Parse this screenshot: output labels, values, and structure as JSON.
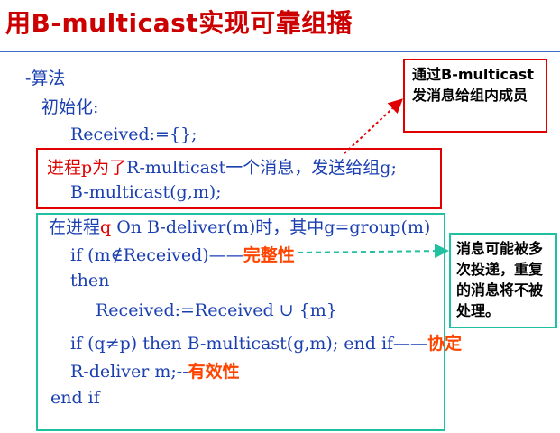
{
  "title": "用B-multicast实现可靠组播",
  "algo_label": "-算法",
  "init_label": "初始化:",
  "received_init": "Received:={};",
  "send_desc_prefix": "进程p为了",
  "send_desc_mid": "R-multicast一个消息，发送给组",
  "send_desc_suffix": "g;",
  "bmulticast_call": "B-multicast(g,m);",
  "deliver_prefix": "在进程",
  "deliver_q": "q",
  "deliver_rest": " On B-deliver(m)时，其中g=group(m)",
  "if_line": "if (m∉Received)——",
  "integrity": "完整性",
  "then_kw": "then",
  "assign_line": "Received:=Received ∪ {m}",
  "if_line2": "if (q≠p) then B-multicast(g,m); end if——",
  "agreement": "协定",
  "rdeliver": "R-deliver m;--",
  "validity": "有效性",
  "endif": "end if",
  "callout_top": "通过B-multicast发消息给组内成员",
  "callout_right": "消息可能被多次投递，重复的消息将不被处理。",
  "colors": {
    "title": "#cc0000",
    "text": "#1a3fb0",
    "red": "#e00000",
    "orange": "#ff4400",
    "green_box": "#20c0a0",
    "red_box": "#e00000"
  }
}
